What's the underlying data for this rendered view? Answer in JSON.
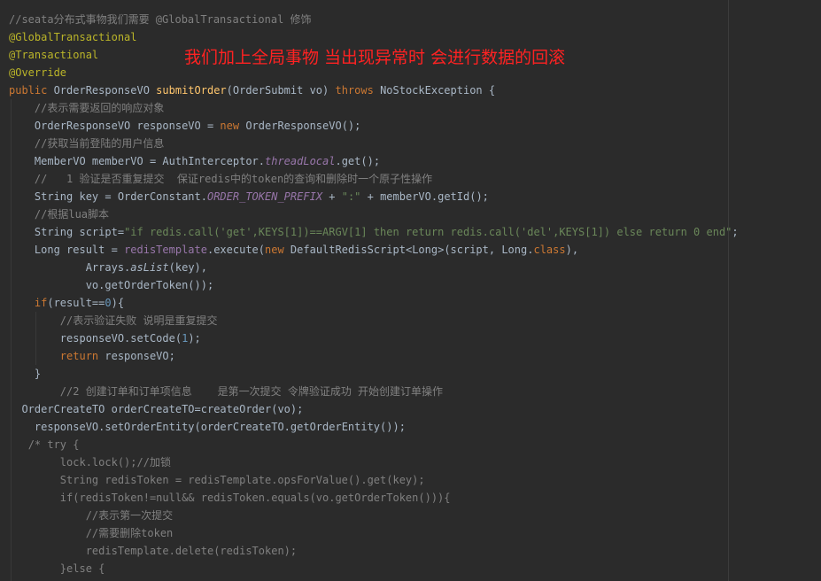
{
  "overlay_note": "我们加上全局事物  当出现异常时 会进行数据的回滚",
  "code": {
    "l1": "//seata分布式事物我们需要 @GlobalTransactional 修饰",
    "l2": "@GlobalTransactional",
    "l3": "@Transactional",
    "l4": "@Override",
    "l5_kw": "public ",
    "l5_type": "OrderResponseVO ",
    "l5_fn": "submitOrder",
    "l5_params": "(OrderSubmit vo) ",
    "l5_throws": "throws ",
    "l5_exc": "NoStockException {",
    "l6": "//表示需要返回的响应对象",
    "l7_a": "OrderResponseVO responseVO = ",
    "l7_new": "new ",
    "l7_b": "OrderResponseVO();",
    "l8": "//获取当前登陆的用户信息",
    "l9_a": "MemberVO memberVO = AuthInterceptor.",
    "l9_field": "threadLocal",
    "l9_b": ".get();",
    "l10": "//   1 验证是否重复提交  保证redis中的token的查询和删除时一个原子性操作",
    "l11_a": "String key = OrderConstant.",
    "l11_field": "ORDER_TOKEN_PREFIX",
    "l11_b": " + ",
    "l11_str": "\":\"",
    "l11_c": " + memberVO.getId();",
    "l12": "//根据lua脚本",
    "l13_a": "String script=",
    "l13_str": "\"if redis.call('get',KEYS[1])==ARGV[1] then return redis.call('del',KEYS[1]) else return 0 end\"",
    "l13_b": ";",
    "l14_a": "Long result = ",
    "l14_fld": "redisTemplate",
    "l14_b": ".execute(",
    "l14_new": "new ",
    "l14_c": "DefaultRedisScript<Long>(script, Long.",
    "l14_class": "class",
    "l14_d": "),",
    "l15_a": "Arrays.",
    "l15_m": "asList",
    "l15_b": "(key),",
    "l16": "vo.getOrderToken());",
    "l17_if": "if",
    "l17_a": "(result==",
    "l17_num": "0",
    "l17_b": "){",
    "l18": "//表示验证失败 说明是重复提交",
    "l19_a": "responseVO.setCode(",
    "l19_num": "1",
    "l19_b": ");",
    "l20_ret": "return ",
    "l20_a": "responseVO;",
    "l21": "}",
    "l22": "//2 创建订单和订单项信息    是第一次提交 令牌验证成功 开始创建订单操作",
    "l23": "OrderCreateTO orderCreateTO=createOrder(vo);",
    "l24": "responseVO.setOrderEntity(orderCreateTO.getOrderEntity());",
    "l25": "/* try {",
    "l26": "lock.lock();//加锁",
    "l27": "String redisToken = redisTemplate.opsForValue().get(key);",
    "l28": "if(redisToken!=null&& redisToken.equals(vo.getOrderToken())){",
    "l29": "//表示第一次提交",
    "l30": "//需要删除token",
    "l31": "redisTemplate.delete(redisToken);",
    "l32": "}else {"
  }
}
